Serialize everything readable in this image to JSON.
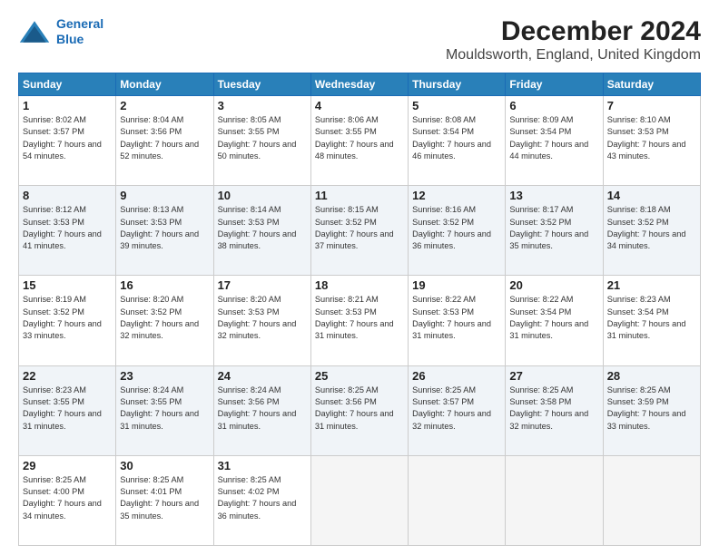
{
  "header": {
    "logo_line1": "General",
    "logo_line2": "Blue",
    "title": "December 2024",
    "subtitle": "Mouldsworth, England, United Kingdom"
  },
  "weekdays": [
    "Sunday",
    "Monday",
    "Tuesday",
    "Wednesday",
    "Thursday",
    "Friday",
    "Saturday"
  ],
  "weeks": [
    [
      {
        "day": "1",
        "sunrise": "8:02 AM",
        "sunset": "3:57 PM",
        "daylight": "7 hours and 54 minutes."
      },
      {
        "day": "2",
        "sunrise": "8:04 AM",
        "sunset": "3:56 PM",
        "daylight": "7 hours and 52 minutes."
      },
      {
        "day": "3",
        "sunrise": "8:05 AM",
        "sunset": "3:55 PM",
        "daylight": "7 hours and 50 minutes."
      },
      {
        "day": "4",
        "sunrise": "8:06 AM",
        "sunset": "3:55 PM",
        "daylight": "7 hours and 48 minutes."
      },
      {
        "day": "5",
        "sunrise": "8:08 AM",
        "sunset": "3:54 PM",
        "daylight": "7 hours and 46 minutes."
      },
      {
        "day": "6",
        "sunrise": "8:09 AM",
        "sunset": "3:54 PM",
        "daylight": "7 hours and 44 minutes."
      },
      {
        "day": "7",
        "sunrise": "8:10 AM",
        "sunset": "3:53 PM",
        "daylight": "7 hours and 43 minutes."
      }
    ],
    [
      {
        "day": "8",
        "sunrise": "8:12 AM",
        "sunset": "3:53 PM",
        "daylight": "7 hours and 41 minutes."
      },
      {
        "day": "9",
        "sunrise": "8:13 AM",
        "sunset": "3:53 PM",
        "daylight": "7 hours and 39 minutes."
      },
      {
        "day": "10",
        "sunrise": "8:14 AM",
        "sunset": "3:53 PM",
        "daylight": "7 hours and 38 minutes."
      },
      {
        "day": "11",
        "sunrise": "8:15 AM",
        "sunset": "3:52 PM",
        "daylight": "7 hours and 37 minutes."
      },
      {
        "day": "12",
        "sunrise": "8:16 AM",
        "sunset": "3:52 PM",
        "daylight": "7 hours and 36 minutes."
      },
      {
        "day": "13",
        "sunrise": "8:17 AM",
        "sunset": "3:52 PM",
        "daylight": "7 hours and 35 minutes."
      },
      {
        "day": "14",
        "sunrise": "8:18 AM",
        "sunset": "3:52 PM",
        "daylight": "7 hours and 34 minutes."
      }
    ],
    [
      {
        "day": "15",
        "sunrise": "8:19 AM",
        "sunset": "3:52 PM",
        "daylight": "7 hours and 33 minutes."
      },
      {
        "day": "16",
        "sunrise": "8:20 AM",
        "sunset": "3:52 PM",
        "daylight": "7 hours and 32 minutes."
      },
      {
        "day": "17",
        "sunrise": "8:20 AM",
        "sunset": "3:53 PM",
        "daylight": "7 hours and 32 minutes."
      },
      {
        "day": "18",
        "sunrise": "8:21 AM",
        "sunset": "3:53 PM",
        "daylight": "7 hours and 31 minutes."
      },
      {
        "day": "19",
        "sunrise": "8:22 AM",
        "sunset": "3:53 PM",
        "daylight": "7 hours and 31 minutes."
      },
      {
        "day": "20",
        "sunrise": "8:22 AM",
        "sunset": "3:54 PM",
        "daylight": "7 hours and 31 minutes."
      },
      {
        "day": "21",
        "sunrise": "8:23 AM",
        "sunset": "3:54 PM",
        "daylight": "7 hours and 31 minutes."
      }
    ],
    [
      {
        "day": "22",
        "sunrise": "8:23 AM",
        "sunset": "3:55 PM",
        "daylight": "7 hours and 31 minutes."
      },
      {
        "day": "23",
        "sunrise": "8:24 AM",
        "sunset": "3:55 PM",
        "daylight": "7 hours and 31 minutes."
      },
      {
        "day": "24",
        "sunrise": "8:24 AM",
        "sunset": "3:56 PM",
        "daylight": "7 hours and 31 minutes."
      },
      {
        "day": "25",
        "sunrise": "8:25 AM",
        "sunset": "3:56 PM",
        "daylight": "7 hours and 31 minutes."
      },
      {
        "day": "26",
        "sunrise": "8:25 AM",
        "sunset": "3:57 PM",
        "daylight": "7 hours and 32 minutes."
      },
      {
        "day": "27",
        "sunrise": "8:25 AM",
        "sunset": "3:58 PM",
        "daylight": "7 hours and 32 minutes."
      },
      {
        "day": "28",
        "sunrise": "8:25 AM",
        "sunset": "3:59 PM",
        "daylight": "7 hours and 33 minutes."
      }
    ],
    [
      {
        "day": "29",
        "sunrise": "8:25 AM",
        "sunset": "4:00 PM",
        "daylight": "7 hours and 34 minutes."
      },
      {
        "day": "30",
        "sunrise": "8:25 AM",
        "sunset": "4:01 PM",
        "daylight": "7 hours and 35 minutes."
      },
      {
        "day": "31",
        "sunrise": "8:25 AM",
        "sunset": "4:02 PM",
        "daylight": "7 hours and 36 minutes."
      },
      null,
      null,
      null,
      null
    ]
  ]
}
